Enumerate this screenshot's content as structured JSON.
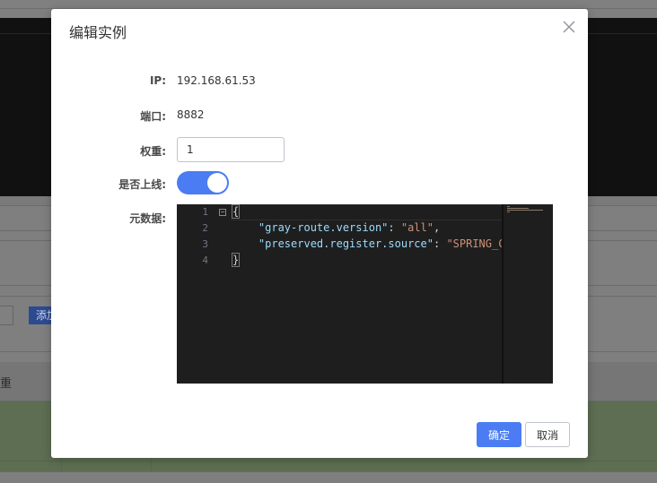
{
  "background": {
    "add_button_label": "添加",
    "table_header_weight": "重"
  },
  "dialog": {
    "title": "编辑实例",
    "close_icon": "close-icon",
    "fields": {
      "ip_label": "IP:",
      "ip_value": "192.168.61.53",
      "port_label": "端口:",
      "port_value": "8882",
      "weight_label": "权重:",
      "weight_value": "1",
      "online_label": "是否上线:",
      "online_enabled": true,
      "metadata_label": "元数据:"
    },
    "editor": {
      "line_numbers": [
        "1",
        "2",
        "3",
        "4"
      ],
      "lines": [
        "{",
        "    \"gray-route.version\": \"all\",",
        "    \"preserved.register.source\": \"SPRING_C",
        "}"
      ],
      "tokens": {
        "key1": "\"gray-route.version\"",
        "val1": "\"all\"",
        "key2": "\"preserved.register.source\"",
        "val2": "\"SPRING_C"
      }
    },
    "buttons": {
      "confirm": "确定",
      "cancel": "取消"
    },
    "colors": {
      "primary": "#4b7cf3",
      "editor_bg": "#1e1e1e",
      "json_key": "#9cdcfe",
      "json_string": "#ce9178"
    }
  }
}
